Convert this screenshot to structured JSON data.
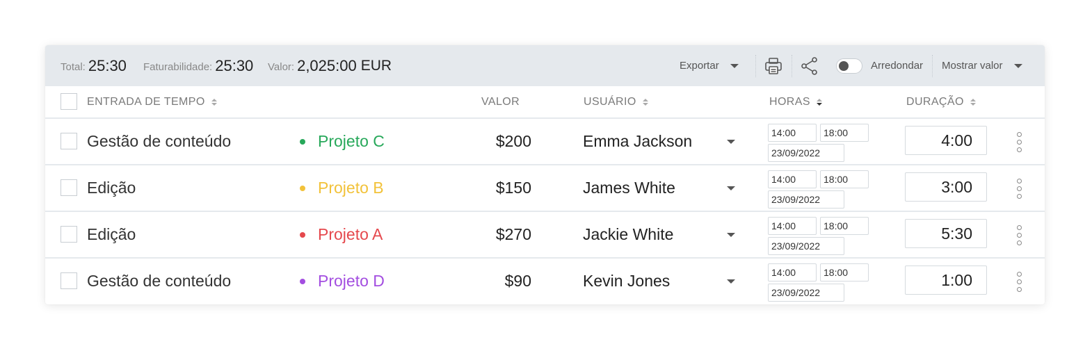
{
  "summary": {
    "total_label": "Total:",
    "total_value": "25:30",
    "billable_label": "Faturabilidade:",
    "billable_value": "25:30",
    "amount_label": "Valor:",
    "amount_value": "2,025:00",
    "amount_currency": "EUR"
  },
  "toolbar": {
    "export_label": "Exportar",
    "print_icon": "printer-icon",
    "share_icon": "share-icon",
    "round_label": "Arredondar",
    "round_enabled": false,
    "show_value_label": "Mostrar valor"
  },
  "columns": {
    "entry": "ENTRADA DE TEMPO",
    "value": "VALOR",
    "user": "USUÁRIO",
    "hours": "HORAS",
    "duration": "DURAÇÃO"
  },
  "rows": [
    {
      "description": "Gestão de conteúdo",
      "project": "Projeto C",
      "project_color": "#27a85a",
      "value": "$200",
      "user": "Emma Jackson",
      "start": "14:00",
      "end": "18:00",
      "date": "23/09/2022",
      "duration": "4:00"
    },
    {
      "description": "Edição",
      "project": "Projeto B",
      "project_color": "#f2c23a",
      "value": "$150",
      "user": "James White",
      "start": "14:00",
      "end": "18:00",
      "date": "23/09/2022",
      "duration": "3:00"
    },
    {
      "description": "Edição",
      "project": "Projeto A",
      "project_color": "#e5484d",
      "value": "$270",
      "user": "Jackie White",
      "start": "14:00",
      "end": "18:00",
      "date": "23/09/2022",
      "duration": "5:30"
    },
    {
      "description": "Gestão de conteúdo",
      "project": "Projeto D",
      "project_color": "#a34ee0",
      "value": "$90",
      "user": "Kevin Jones",
      "start": "14:00",
      "end": "18:00",
      "date": "23/09/2022",
      "duration": "1:00"
    }
  ]
}
